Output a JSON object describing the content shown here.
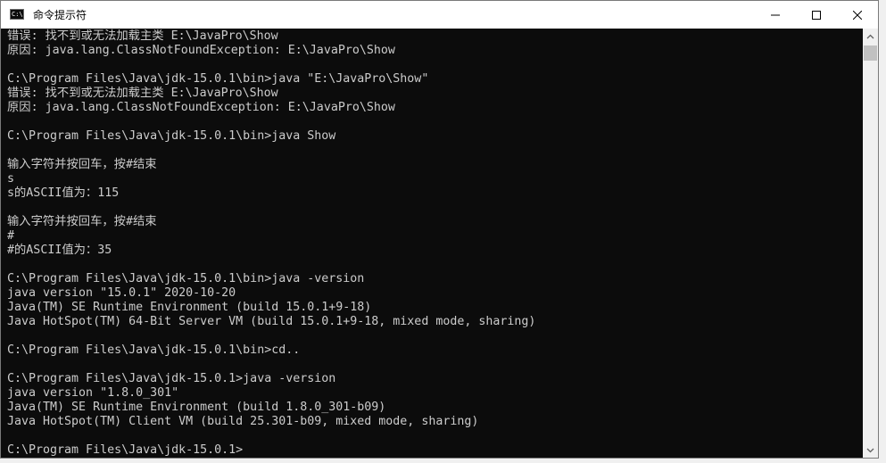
{
  "window": {
    "title": "命令提示符",
    "app_icon_label": "C:\\",
    "controls": {
      "minimize": "minimize-icon",
      "maximize": "maximize-icon",
      "close": "close-icon"
    }
  },
  "console": {
    "background": "#0c0c0c",
    "foreground": "#cccccc",
    "lines": [
      "错误: 找不到或无法加载主类 E:\\JavaPro\\Show",
      "原因: java.lang.ClassNotFoundException: E:\\JavaPro\\Show",
      "",
      "C:\\Program Files\\Java\\jdk-15.0.1\\bin>java \"E:\\JavaPro\\Show\"",
      "错误: 找不到或无法加载主类 E:\\JavaPro\\Show",
      "原因: java.lang.ClassNotFoundException: E:\\JavaPro\\Show",
      "",
      "C:\\Program Files\\Java\\jdk-15.0.1\\bin>java Show",
      "",
      "输入字符并按回车，按#结束",
      "s",
      "s的ASCII值为：115",
      "",
      "输入字符并按回车，按#结束",
      "#",
      "#的ASCII值为：35",
      "",
      "C:\\Program Files\\Java\\jdk-15.0.1\\bin>java -version",
      "java version \"15.0.1\" 2020-10-20",
      "Java(TM) SE Runtime Environment (build 15.0.1+9-18)",
      "Java HotSpot(TM) 64-Bit Server VM (build 15.0.1+9-18, mixed mode, sharing)",
      "",
      "C:\\Program Files\\Java\\jdk-15.0.1\\bin>cd..",
      "",
      "C:\\Program Files\\Java\\jdk-15.0.1>java -version",
      "java version \"1.8.0_301\"",
      "Java(TM) SE Runtime Environment (build 1.8.0_301-b09)",
      "Java HotSpot(TM) Client VM (build 25.301-b09, mixed mode, sharing)",
      "",
      "C:\\Program Files\\Java\\jdk-15.0.1>"
    ]
  },
  "scrollbar": {
    "up_icon": "chevron-up-icon",
    "down_icon": "chevron-down-icon",
    "position": 0.0
  }
}
